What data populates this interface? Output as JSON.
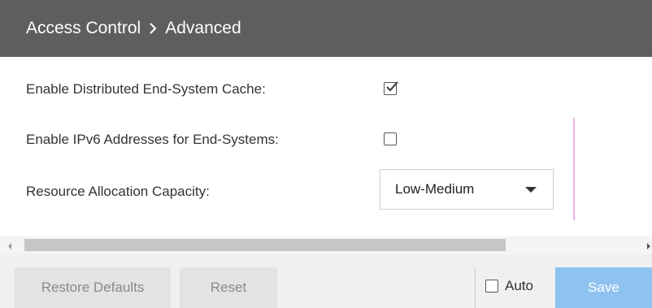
{
  "header": {
    "breadcrumb": [
      "Access Control",
      "Advanced"
    ],
    "separator_icon": "chevron-right-icon"
  },
  "settings": {
    "distributed_cache": {
      "label": "Enable Distributed End-System Cache:",
      "checked": true
    },
    "ipv6": {
      "label": "Enable IPv6 Addresses for End-Systems:",
      "checked": false
    },
    "capacity": {
      "label": "Resource Allocation Capacity:",
      "value": "Low-Medium"
    }
  },
  "footer": {
    "restore_label": "Restore Defaults",
    "reset_label": "Reset",
    "auto_label": "Auto",
    "auto_checked": false,
    "save_label": "Save"
  },
  "colors": {
    "header_bg": "#5e5e5e",
    "save_bg": "#8ec3ef",
    "disabled_button_bg": "#e3e3e3"
  }
}
